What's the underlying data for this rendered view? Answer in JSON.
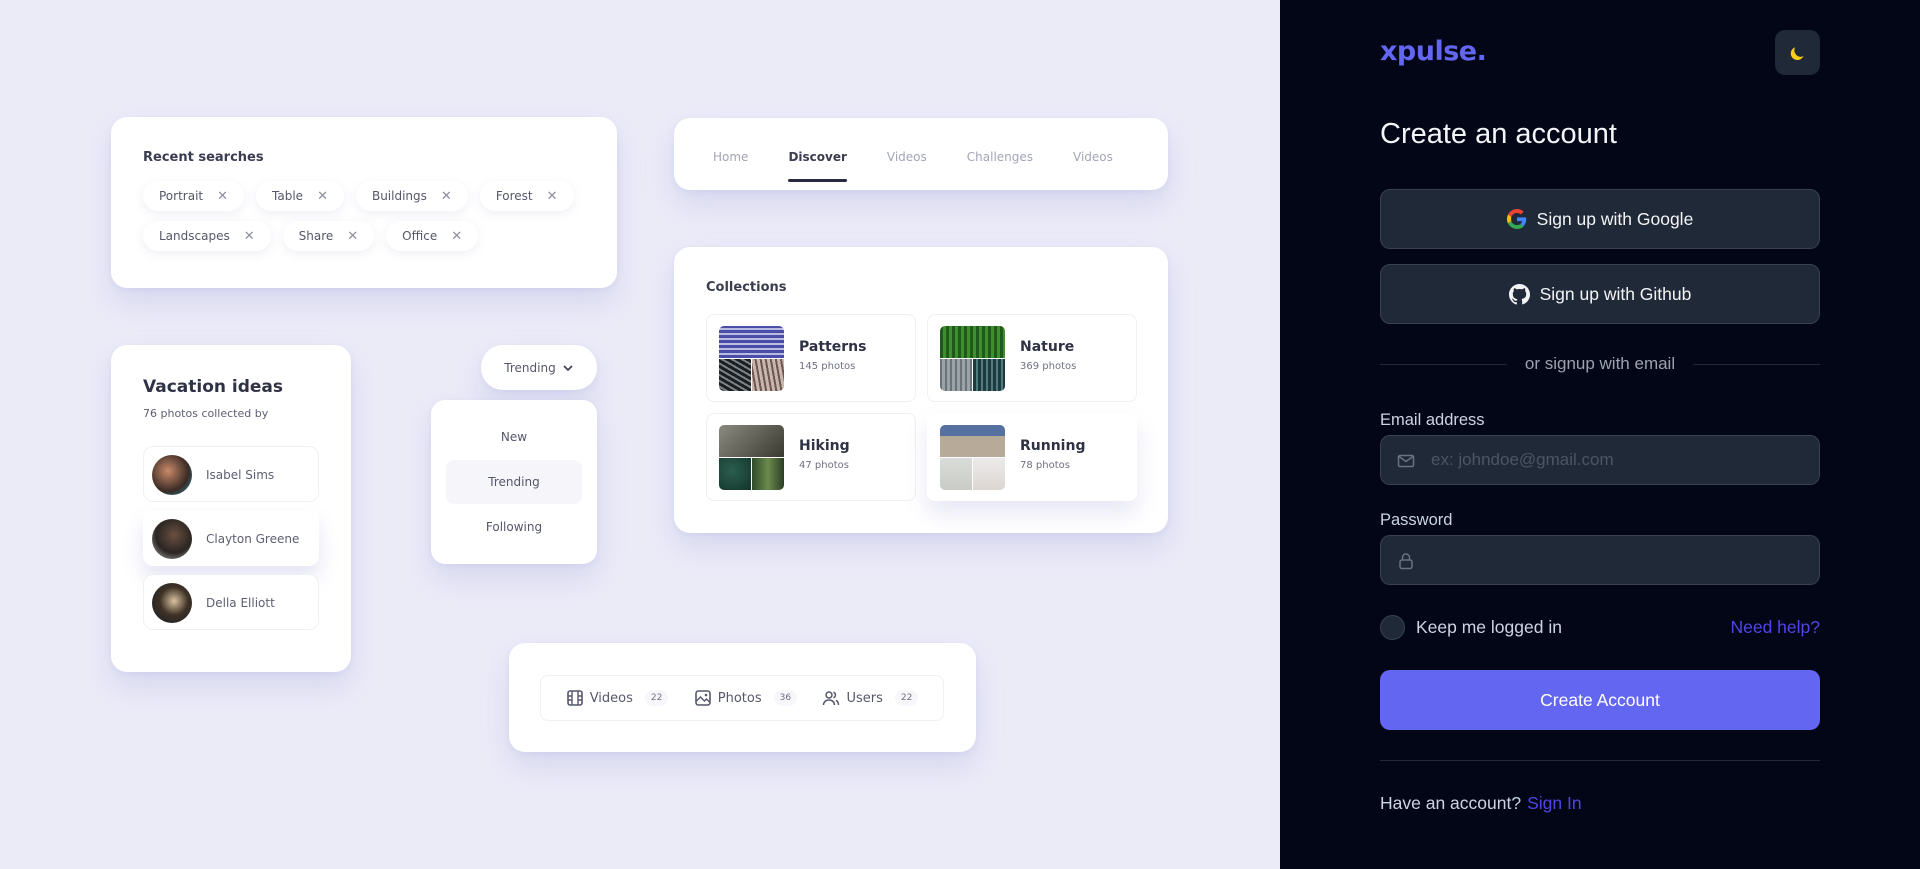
{
  "illustration": {
    "recent_searches": {
      "title": "Recent searches",
      "chips": [
        "Portrait",
        "Table",
        "Buildings",
        "Forest",
        "Landscapes",
        "Share",
        "Office"
      ],
      "remove_glyph": "✕"
    },
    "nav_tabs": {
      "items": [
        "Home",
        "Discover",
        "Videos",
        "Challenges",
        "Videos"
      ],
      "active": "Discover"
    },
    "collections": {
      "title": "Collections",
      "items": [
        {
          "name": "Patterns",
          "count": "145 photos"
        },
        {
          "name": "Nature",
          "count": "369 photos"
        },
        {
          "name": "Hiking",
          "count": "47 photos"
        },
        {
          "name": "Running",
          "count": "78 photos"
        }
      ]
    },
    "vacation": {
      "title": "Vacation ideas",
      "subtitle": "76 photos collected by",
      "people": [
        "Isabel Sims",
        "Clayton Greene",
        "Della Elliott"
      ]
    },
    "sort": {
      "selected": "Trending",
      "options": [
        "New",
        "Trending",
        "Following"
      ]
    },
    "filters": [
      {
        "label": "Videos",
        "count": "22",
        "icon": "film-icon"
      },
      {
        "label": "Photos",
        "count": "36",
        "icon": "image-icon"
      },
      {
        "label": "Users",
        "count": "22",
        "icon": "users-icon"
      }
    ]
  },
  "signup": {
    "logo": "xpulse.",
    "theme_toggle_icon": "moon-icon",
    "title": "Create an account",
    "google_label": "Sign up with Google",
    "github_label": "Sign up with Github",
    "separator": "or signup with email",
    "email": {
      "label": "Email address",
      "placeholder": "ex: johndoe@gmail.com",
      "value": ""
    },
    "password": {
      "label": "Password",
      "placeholder": "",
      "value": ""
    },
    "remember_label": "Keep me logged in",
    "remember_checked": false,
    "help_link": "Need help?",
    "submit_label": "Create Account",
    "footer_text": "Have an account?",
    "signin_link": "Sign In"
  },
  "colors": {
    "accent": "#6366f1",
    "link": "#4f46e5",
    "panel_bg": "#030617",
    "field_bg": "#1f2937",
    "illustration_bg": "#ebebf8",
    "moon": "#facc15"
  }
}
